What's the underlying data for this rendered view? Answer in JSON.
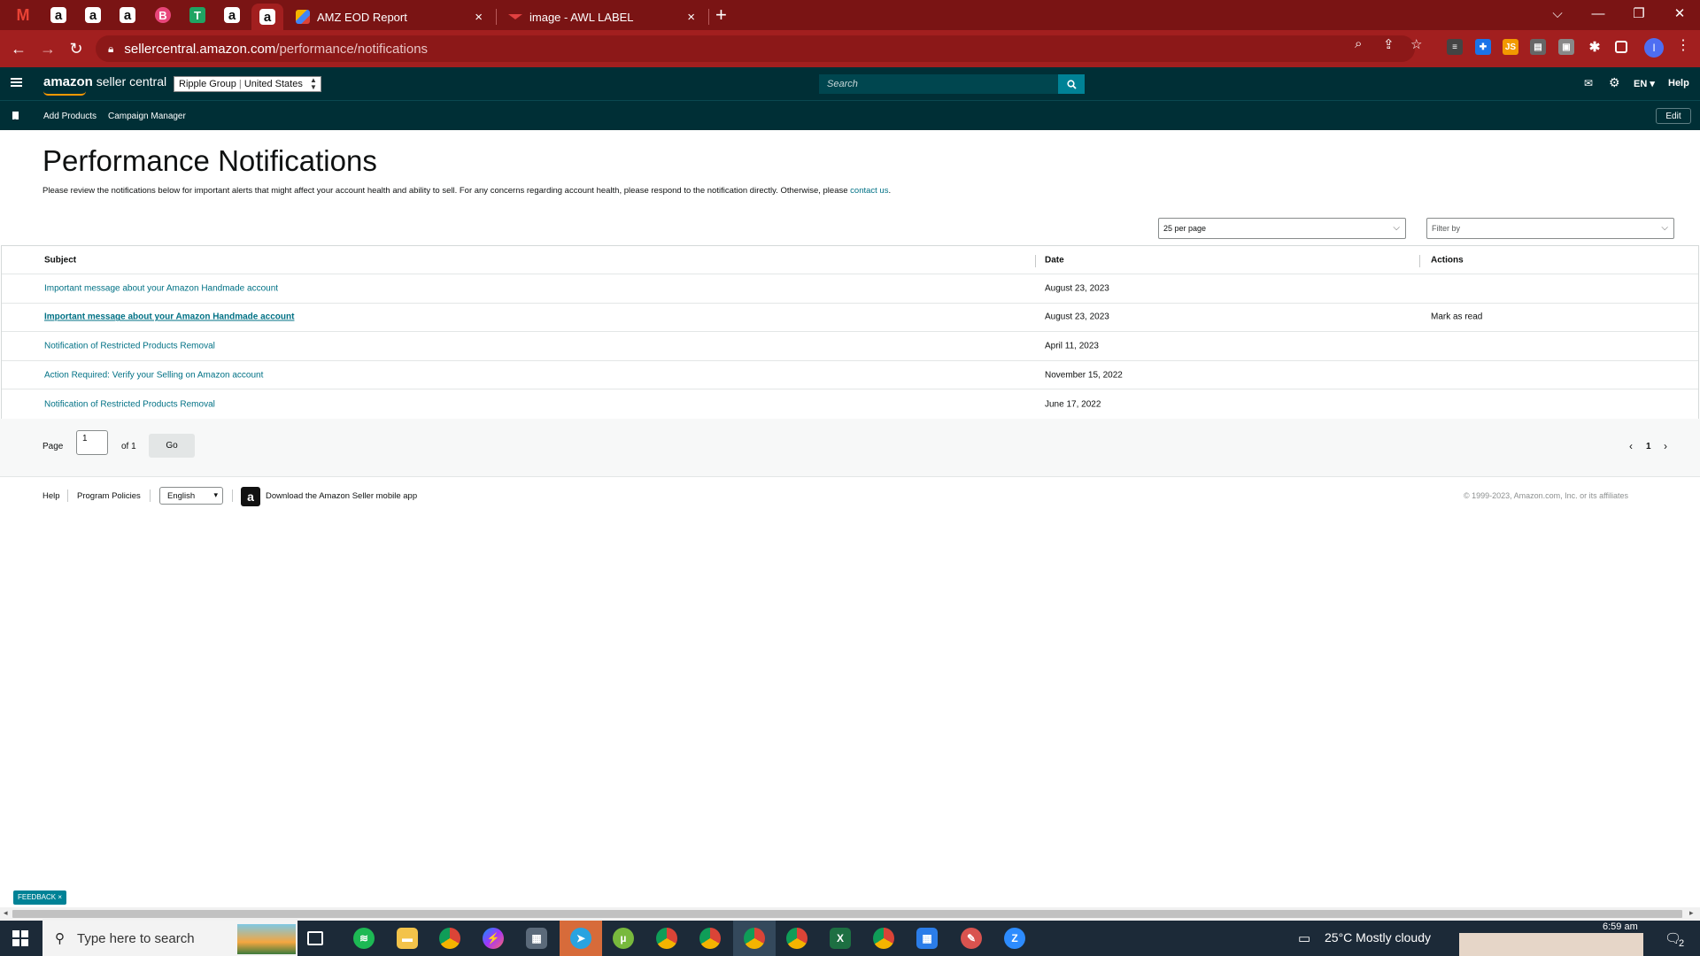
{
  "browser": {
    "tabs": [
      {
        "title": "AMZ EOD Report",
        "close": "×"
      },
      {
        "title": "image - AWL LABEL",
        "close": "×"
      }
    ],
    "pinned": [
      {
        "icon": "gmail-icon",
        "glyph": "M"
      },
      {
        "icon": "amazon-icon",
        "glyph": "a"
      },
      {
        "icon": "amazon-icon",
        "glyph": "a"
      },
      {
        "icon": "amazon-icon",
        "glyph": "a"
      },
      {
        "icon": "b-icon",
        "glyph": "B"
      },
      {
        "icon": "sheets-icon",
        "glyph": "T"
      },
      {
        "icon": "amazon-icon",
        "glyph": "a"
      },
      {
        "icon": "amazon-icon",
        "glyph": "a"
      }
    ],
    "new_tab": "+",
    "url_host": "sellercentral.amazon.com",
    "url_path": "/performance/notifications",
    "profile_initial": "I"
  },
  "header": {
    "logo_brand": "amazon",
    "logo_product": " seller central",
    "account": "Ripple Group",
    "account_sep": " | ",
    "marketplace": "United States",
    "search_placeholder": "Search",
    "language": "EN",
    "help": "Help"
  },
  "subnav": {
    "links": [
      "Add Products",
      "Campaign Manager"
    ],
    "edit": "Edit"
  },
  "page": {
    "title": "Performance Notifications",
    "description": "Please review the notifications below for important alerts that might affect your account health and ability to sell. For any concerns regarding account health, please respond to the notification directly. Otherwise, please ",
    "contact_link": "contact us",
    "description_end": ".",
    "per_page": "25 per page",
    "filter_placeholder": "Filter by"
  },
  "table": {
    "headers": {
      "subject": "Subject",
      "date": "Date",
      "actions": "Actions"
    },
    "rows": [
      {
        "subject": "Important message about your Amazon Handmade account",
        "date": "August 23, 2023",
        "action": "",
        "unread": false
      },
      {
        "subject": "Important message about your Amazon Handmade account",
        "date": "August 23, 2023",
        "action": "Mark as read",
        "unread": true
      },
      {
        "subject": "Notification of Restricted Products Removal",
        "date": "April 11, 2023",
        "action": "",
        "unread": false
      },
      {
        "subject": "Action Required: Verify your Selling on Amazon account",
        "date": "November 15, 2022",
        "action": "",
        "unread": false
      },
      {
        "subject": "Notification of Restricted Products Removal",
        "date": "June 17, 2022",
        "action": "",
        "unread": false
      }
    ]
  },
  "pager": {
    "page_label": "Page",
    "page_value": "1",
    "of_label": "of 1",
    "go": "Go",
    "current": "1"
  },
  "footer": {
    "help": "Help",
    "policies": "Program Policies",
    "language": "English",
    "app_text": "Download the Amazon Seller mobile app",
    "copyright": "© 1999-2023, Amazon.com, Inc. or its affiliates"
  },
  "feedback": "FEEDBACK ×",
  "taskbar": {
    "search_placeholder": "Type here to search",
    "weather": "25°C  Mostly cloudy",
    "time": "6:59 am",
    "notifications": "2"
  },
  "colors": {
    "browser_frame": "#7a1414",
    "browser_toolbar": "#a21f1f",
    "seller_header": "#002f36",
    "link": "#007185",
    "search_button": "#008296"
  }
}
